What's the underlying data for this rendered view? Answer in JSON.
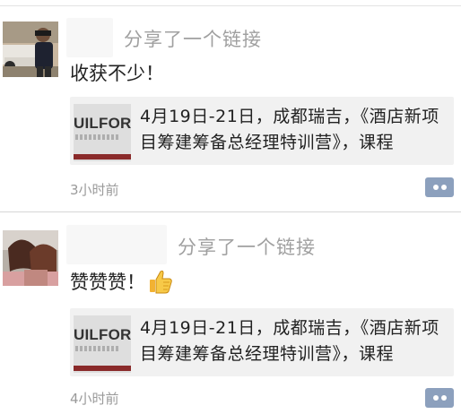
{
  "feed": {
    "posts": [
      {
        "shared_label": "分享了一个链接",
        "text": "收获不少！",
        "link": {
          "thumb_text": "UILFOR",
          "title": "4月19日-21日，成都瑞吉，《酒店新项目筹建筹备总经理特训营》，课程"
        },
        "time": "3小时前",
        "avatar_icon": "avatar-photo-man-with-car",
        "comment_icon": "comment-dots-icon"
      },
      {
        "shared_label": "分享了一个链接",
        "text": "赞赞赞！",
        "emoji": "thumbs-up-icon",
        "link": {
          "thumb_text": "UILFOR",
          "title": "4月19日-21日，成都瑞吉，《酒店新项目筹建筹备总经理特训营》，课程"
        },
        "time": "4小时前",
        "avatar_icon": "avatar-photo-two-women",
        "comment_icon": "comment-dots-icon"
      }
    ]
  },
  "colors": {
    "comment_button": "#8ca0bd",
    "link_card_bg": "#f1f1f1",
    "secondary_text": "#a0a0a0",
    "thumb_bar": "#8a2a2a"
  }
}
